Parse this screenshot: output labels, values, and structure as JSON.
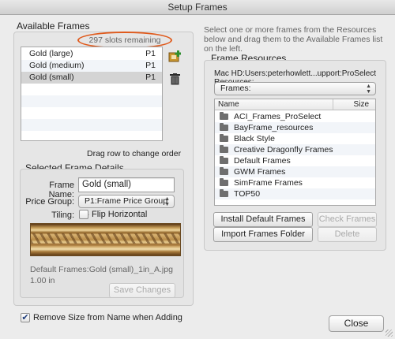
{
  "window": {
    "title": "Setup Frames"
  },
  "available_frames": {
    "title": "Available Frames",
    "slots_remaining": "297 slots remaining",
    "items": [
      {
        "name": "Gold (large)",
        "price": "P1",
        "selected": false
      },
      {
        "name": "Gold (medium)",
        "price": "P1",
        "selected": false
      },
      {
        "name": "Gold (small)",
        "price": "P1",
        "selected": true
      }
    ],
    "drag_hint": "Drag row to change order",
    "add_icon": "add-frame-icon",
    "delete_icon": "trash-icon"
  },
  "selected_frame": {
    "title": "Selected Frame Details",
    "name_label": "Frame Name:",
    "name_value": "Gold (small)",
    "price_group_label": "Price Group:",
    "price_group_value": "P1:Frame Price Group 1",
    "tiling_label": "Tiling:",
    "flip_horizontal_label": "Flip Horizontal",
    "flip_horizontal_checked": false,
    "file_name": "Default Frames:Gold (small)_1in_A.jpg",
    "size": "1.00 in",
    "save_button": "Save Changes"
  },
  "instructions": "Select one or more frames from the Resources below and drag them to the Available Frames list on the left.",
  "resources": {
    "title": "Frame Resources",
    "path": "Mac HD:Users:peterhowlett...upport:ProSelect Resources:",
    "folder_popup": "Frames:",
    "columns": {
      "name": "Name",
      "size": "Size"
    },
    "items": [
      "ACI_Frames_ProSelect",
      "BayFrame_resources",
      "Black Style",
      "Creative Dragonfly Frames",
      "Default Frames",
      "GWM Frames",
      "SimFrame Frames",
      "TOP50"
    ],
    "buttons": {
      "install_default": "Install Default Frames",
      "check_frames": "Check Frames",
      "import_folder": "Import Frames Folder",
      "delete": "Delete"
    }
  },
  "footer": {
    "remove_size_label": "Remove Size from Name when Adding",
    "remove_size_checked": true,
    "close_button": "Close"
  },
  "colors": {
    "highlight_ring": "#e05a1c",
    "selected_row": "#d4d4d4"
  }
}
